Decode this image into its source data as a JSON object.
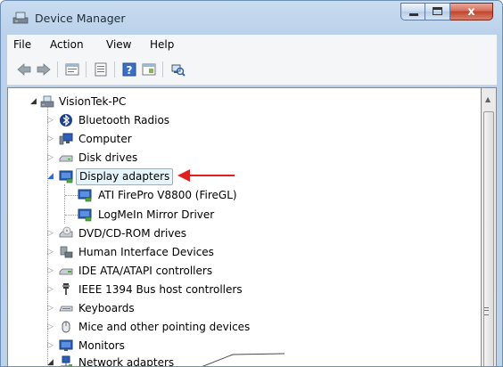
{
  "window": {
    "title": "Device Manager",
    "accent": "#bcd3ec"
  },
  "caption_buttons": {
    "minimize_icon": "minimize-icon",
    "maximize_icon": "maximize-icon",
    "close_label": "x"
  },
  "menu": [
    "File",
    "Action",
    "View",
    "Help"
  ],
  "toolbar": [
    "back-icon",
    "forward-icon",
    "properties-icon",
    "console-tree-icon",
    "help-icon",
    "view-icon",
    "scan-hardware-icon"
  ],
  "tree": {
    "root": "VisionTek-PC",
    "categories": {
      "bluetooth": "Bluetooth Radios",
      "computer": "Computer",
      "disk": "Disk drives",
      "display": "Display adapters",
      "dvd": "DVD/CD-ROM drives",
      "hid": "Human Interface Devices",
      "ide": "IDE ATA/ATAPI controllers",
      "ieee": "IEEE 1394 Bus host controllers",
      "keyboards": "Keyboards",
      "mice": "Mice and other pointing devices",
      "monitors": "Monitors",
      "network": "Network adapters"
    },
    "display_children": [
      "ATI FirePro V8800 (FireGL)",
      "LogMeIn Mirror Driver"
    ],
    "selected": "Display adapters"
  },
  "annotation": {
    "arrow_color": "#e02020"
  }
}
